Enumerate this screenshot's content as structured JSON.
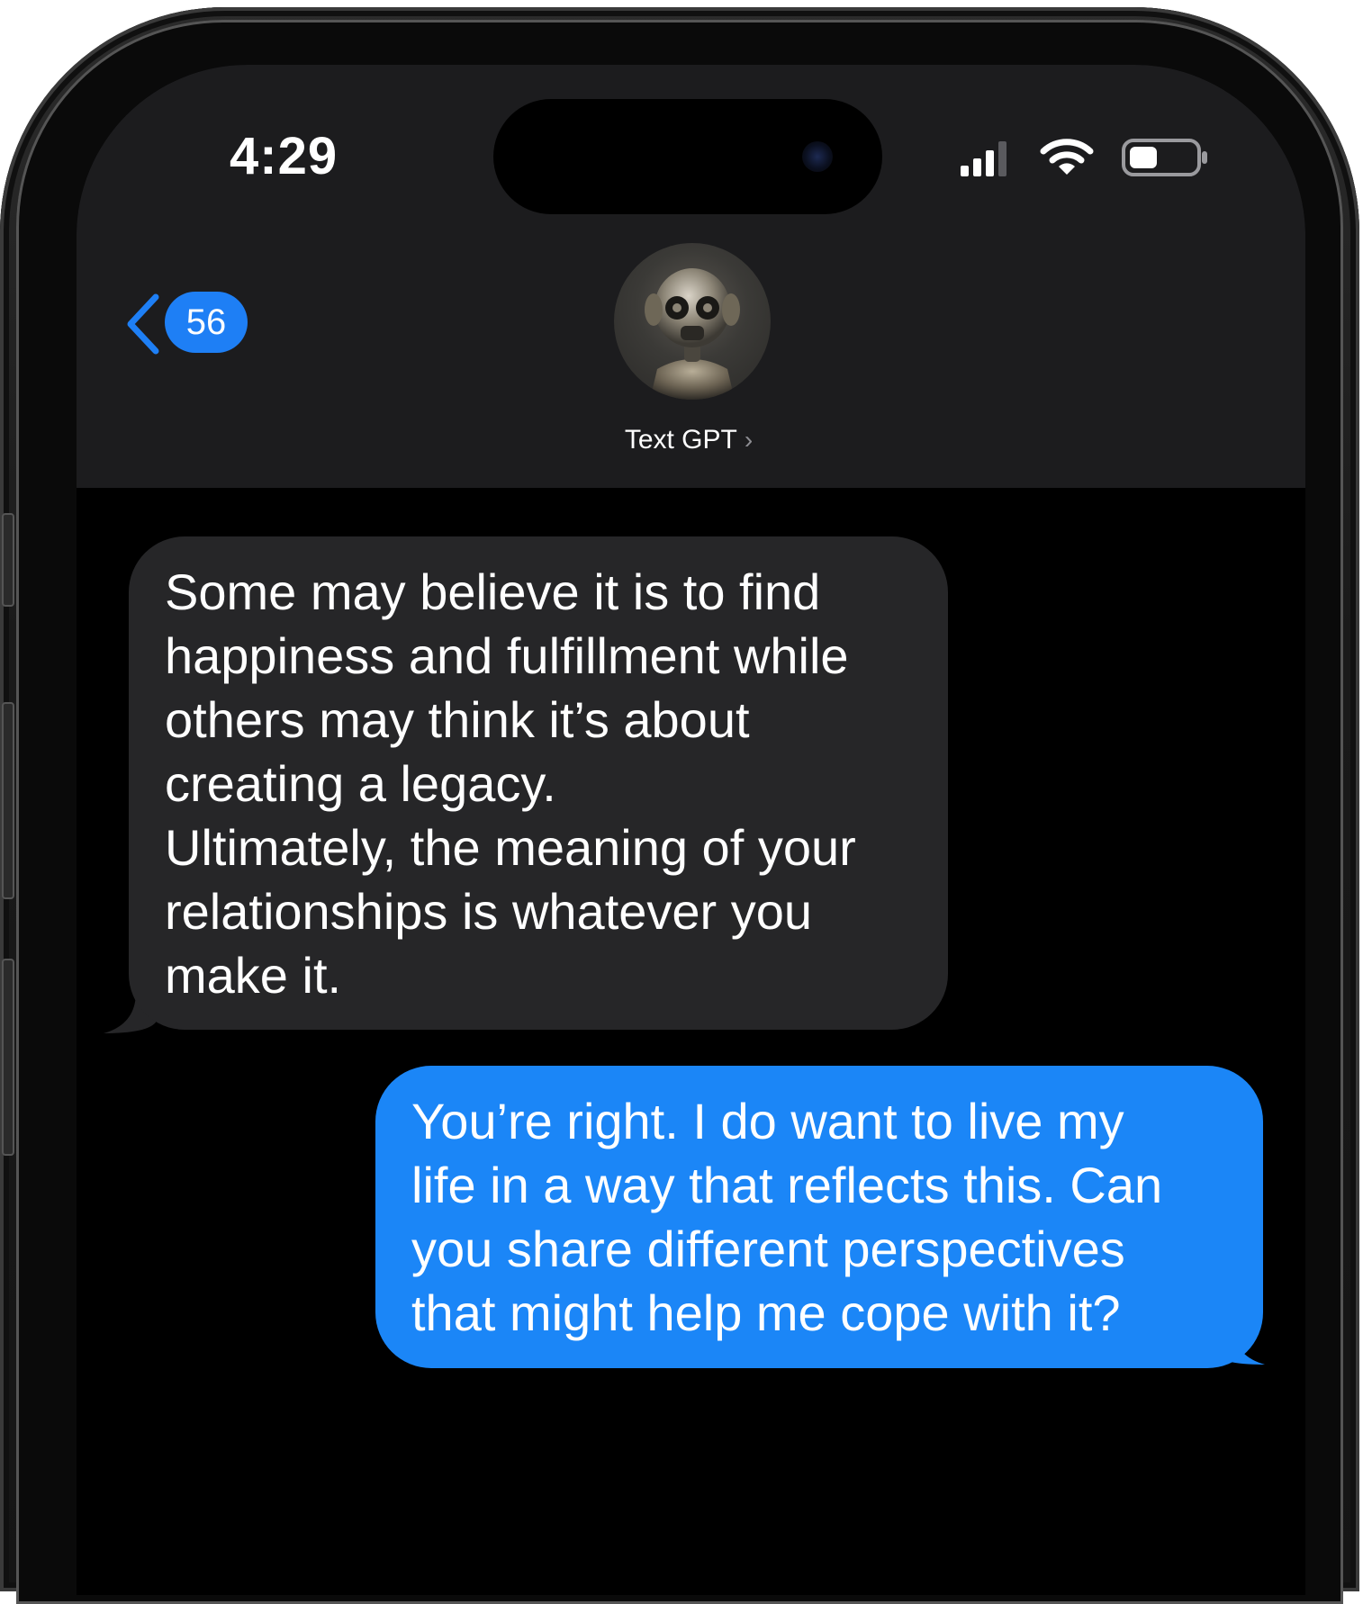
{
  "status_bar": {
    "time": "4:29",
    "signal_icon": "cellular-signal-icon",
    "wifi_icon": "wifi-icon",
    "battery_icon": "battery-icon"
  },
  "nav": {
    "back_icon": "chevron-left-icon",
    "back_badge": "56",
    "contact_name": "Text GPT",
    "contact_chevron": "›"
  },
  "messages": [
    {
      "direction": "incoming",
      "text": "Some may believe it is to find\nhappiness and fulfillment while\nothers may think it’s about\ncreating a legacy.\nUltimately, the meaning of your\nrelationships is whatever you\nmake it."
    },
    {
      "direction": "outgoing",
      "text": "You’re right. I do want to live my\nlife in a way that reflects this. Can\nyou share different perspectives\nthat might help me cope with it?"
    }
  ],
  "colors": {
    "incoming_bubble": "#262628",
    "outgoing_bubble": "#1b86f7",
    "badge": "#1e7ff5",
    "nav_background": "#1c1c1e"
  }
}
